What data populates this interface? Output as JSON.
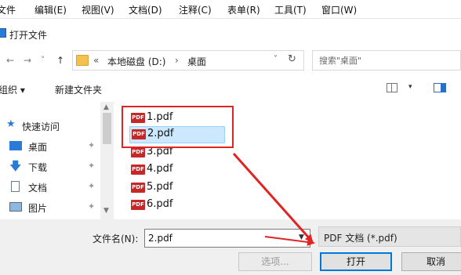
{
  "menubar": {
    "items": [
      "文件",
      "编辑(E)",
      "视图(V)",
      "文档(D)",
      "注释(C)",
      "表单(R)",
      "工具(T)",
      "窗口(W)"
    ]
  },
  "dialog": {
    "title": "打开文件"
  },
  "address": {
    "back": "←",
    "forward": "→",
    "recent": "˅",
    "up": "↑",
    "overflow": "«",
    "segments": [
      "本地磁盘 (D:)",
      "›",
      "桌面"
    ],
    "dropdown": "˅",
    "refresh": "↻"
  },
  "search": {
    "placeholder": "搜索\"桌面\""
  },
  "toolbar": {
    "organize": "组织 ▾",
    "new_folder": "新建文件夹",
    "view_dropdown": "▾"
  },
  "nav": {
    "items": [
      {
        "label": "快速访问",
        "icon": "star-icon"
      },
      {
        "label": "桌面",
        "icon": "desktop-icon",
        "pin": "📌"
      },
      {
        "label": "下载",
        "icon": "download-icon",
        "pin": "📌"
      },
      {
        "label": "文档",
        "icon": "document-icon",
        "pin": "📌"
      },
      {
        "label": "图片",
        "icon": "pictures-icon",
        "pin": "📌"
      }
    ]
  },
  "files": {
    "icon_label": "PDF",
    "items": [
      {
        "name": "1.pdf",
        "selected": false
      },
      {
        "name": "2.pdf",
        "selected": true
      },
      {
        "name": "3.pdf",
        "selected": false
      },
      {
        "name": "4.pdf",
        "selected": false
      },
      {
        "name": "5.pdf",
        "selected": false
      },
      {
        "name": "6.pdf",
        "selected": false
      }
    ]
  },
  "bottom": {
    "filename_label": "文件名(N):",
    "filename_value": "2.pdf",
    "filetype_value": "PDF 文档 (*.pdf)",
    "options_button": "选项...",
    "open_button": "打开",
    "cancel_button": "取消"
  },
  "colors": {
    "highlight": "#e02424",
    "selection_bg": "#cce8ff",
    "pdf_icon": "#c62828",
    "accent": "#0078d7"
  }
}
